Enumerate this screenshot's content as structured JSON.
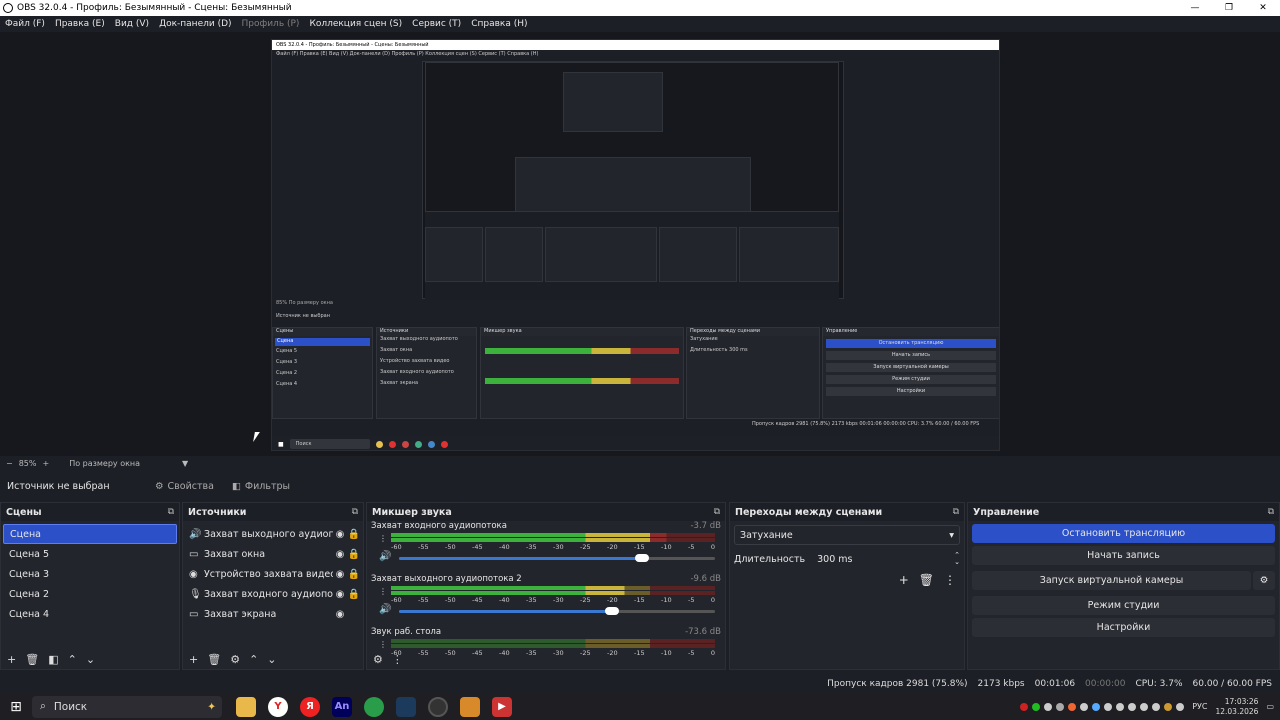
{
  "titlebar": {
    "title": "OBS 32.0.4 - Профиль: Безымянный - Сцены: Безымянный",
    "minimize": "—",
    "maximize": "❐",
    "close": "✕"
  },
  "menu": [
    "Файл (F)",
    "Правка (E)",
    "Вид (V)",
    "Док-панели (D)",
    "Профиль (P)",
    "Коллекция сцен (S)",
    "Сервис (T)",
    "Справка (H)"
  ],
  "nested": {
    "title": "OBS 32.0.4 - Профиль: Безымянный - Сцены: Безымянный",
    "menu": "Файл (F)   Правка (E)   Вид (V)   Док-панели (D)   Профиль (P)   Коллекция сцен (S)   Сервис (T)   Справка (H)",
    "zoom": "85%   По размеру окна",
    "ctx": "Источник не выбран",
    "scenes_header": "Сцены",
    "scenes": [
      "Сцена",
      "Сцена 5",
      "Сцена 3",
      "Сцена 2",
      "Сцена 4"
    ],
    "sources_header": "Источники",
    "sources": [
      "Захват выходного аудиопото",
      "Захват окна",
      "Устройство захвата видео",
      "Захват входного аудиопото",
      "Захват экрана"
    ],
    "mixer_header": "Микшер звука",
    "trans_header": "Переходы между сценами",
    "trans_value": "Затухание",
    "trans_dur": "Длительность   300 ms",
    "ctl_header": "Управление",
    "ctl_buttons": [
      "Остановить трансляцию",
      "Начать запись",
      "Запуск виртуальной камеры",
      "Режим студии",
      "Настройки"
    ],
    "search": "Поиск",
    "status": "Пропуск кадров 2981 (75.8%)   2173 kbps   00:01:06   00:00:00   CPU: 3.7%   60.00 / 60.00 FPS"
  },
  "zoombar": {
    "minus": "−",
    "zoom": "85%",
    "plus": "+",
    "fit": "По размеру окна",
    "arrow": "▼"
  },
  "context": {
    "label": "Источник не выбран",
    "props": "Свойства",
    "filters": "Фильтры"
  },
  "scenes": {
    "title": "Сцены",
    "items": [
      "Сцена",
      "Сцена 5",
      "Сцена 3",
      "Сцена 2",
      "Сцена 4"
    ]
  },
  "sources": {
    "title": "Источники",
    "items": [
      {
        "icon": "🔊",
        "name": "Захват выходного аудиопотока"
      },
      {
        "icon": "▭",
        "name": "Захват окна"
      },
      {
        "icon": "◉",
        "name": "Устройство захвата видео"
      },
      {
        "icon": "🎙",
        "name": "Захват входного аудиопотока"
      },
      {
        "icon": "▭",
        "name": "Захват экрана"
      }
    ]
  },
  "mixer": {
    "title": "Микшер звука",
    "channels": [
      {
        "name": "Захват входного аудиопотока",
        "db": "-3.7 dB",
        "level": 0.85,
        "volume": 0.82
      },
      {
        "name": "Захват выходного аудиопотока 2",
        "db": "-9.6 dB",
        "level": 0.72,
        "volume": 0.72
      },
      {
        "name": "Звук раб. стола",
        "db": "-73.6 dB",
        "level": 0,
        "volume": 0.85
      }
    ],
    "ticks": [
      "-60",
      "-55",
      "-50",
      "-45",
      "-40",
      "-35",
      "-30",
      "-25",
      "-20",
      "-15",
      "-10",
      "-5",
      "0"
    ]
  },
  "transitions": {
    "title": "Переходы между сценами",
    "selected": "Затухание",
    "duration_label": "Длительность",
    "duration": "300 ms"
  },
  "controls": {
    "title": "Управление",
    "stream": "Остановить трансляцию",
    "record": "Начать запись",
    "vcam": "Запуск виртуальной камеры",
    "studio": "Режим студии",
    "settings": "Настройки"
  },
  "status": {
    "dropped": "Пропуск кадров 2981 (75.8%)",
    "kbps": "2173 kbps",
    "stream_time": "00:01:06",
    "rec_time": "00:00:00",
    "cpu": "CPU: 3.7%",
    "fps": "60.00 / 60.00 FPS"
  },
  "taskbar": {
    "search": "Поиск",
    "lang": "РУС",
    "time": "17:03:26",
    "date": "12.03.2026"
  },
  "colors": {
    "accent": "#2b50c8",
    "bg": "#1d1f26",
    "panel": "#23252c"
  }
}
